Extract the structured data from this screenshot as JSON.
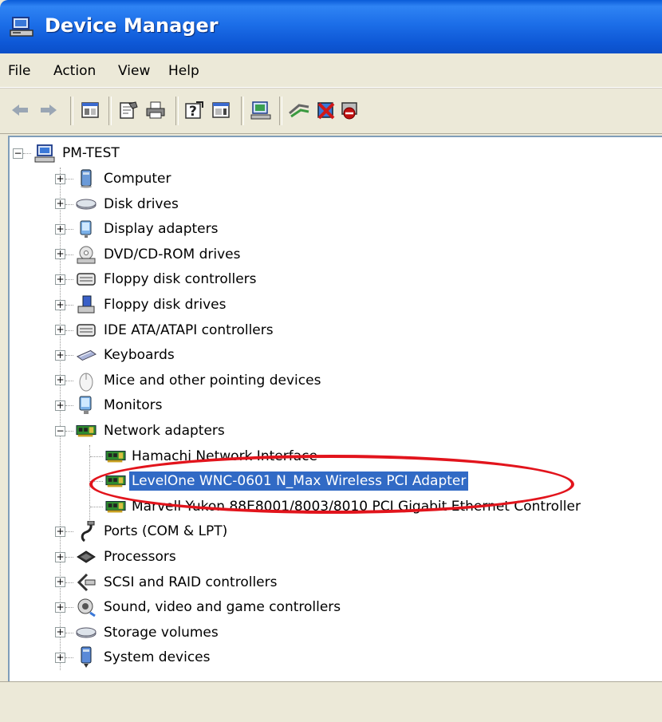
{
  "window": {
    "title": "Device Manager",
    "accent": "#316ac5",
    "annotation_color": "#e2141c"
  },
  "menu": [
    "File",
    "Action",
    "View",
    "Help"
  ],
  "toolbar": [
    "back-arrow-icon",
    "forward-arrow-icon",
    "show-hide-tree-icon",
    "properties-icon",
    "print-icon",
    "help-icon",
    "action-pane-icon",
    "scan-hardware-icon",
    "update-driver-icon",
    "uninstall-icon",
    "disable-icon"
  ],
  "tree": {
    "root": "PM-TEST",
    "categories": [
      {
        "label": "Computer",
        "icon": "computer-icon"
      },
      {
        "label": "Disk drives",
        "icon": "disk-drive-icon"
      },
      {
        "label": "Display adapters",
        "icon": "display-adapter-icon"
      },
      {
        "label": "DVD/CD-ROM drives",
        "icon": "dvd-drive-icon"
      },
      {
        "label": "Floppy disk controllers",
        "icon": "controller-icon"
      },
      {
        "label": "Floppy disk drives",
        "icon": "floppy-drive-icon"
      },
      {
        "label": "IDE ATA/ATAPI controllers",
        "icon": "controller-icon"
      },
      {
        "label": "Keyboards",
        "icon": "keyboard-icon"
      },
      {
        "label": "Mice and other pointing devices",
        "icon": "mouse-icon"
      },
      {
        "label": "Monitors",
        "icon": "monitor-icon"
      },
      {
        "label": "Network adapters",
        "icon": "network-adapter-icon",
        "expanded": true,
        "children": [
          {
            "label": "Hamachi Network Interface"
          },
          {
            "label": "LevelOne WNC-0601 N_Max Wireless PCI Adapter",
            "selected": true
          },
          {
            "label": "Marvell Yukon 88E8001/8003/8010 PCI Gigabit Ethernet Controller"
          }
        ]
      },
      {
        "label": "Ports (COM & LPT)",
        "icon": "port-icon"
      },
      {
        "label": "Processors",
        "icon": "processor-icon"
      },
      {
        "label": "SCSI and RAID controllers",
        "icon": "scsi-icon"
      },
      {
        "label": "Sound, video and game controllers",
        "icon": "sound-icon"
      },
      {
        "label": "Storage volumes",
        "icon": "storage-volume-icon"
      },
      {
        "label": "System devices",
        "icon": "system-device-icon"
      }
    ]
  }
}
